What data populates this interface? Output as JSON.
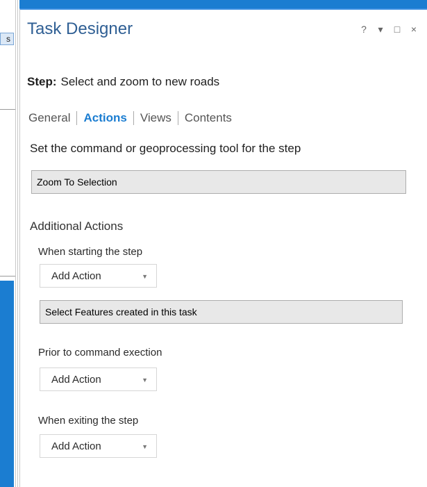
{
  "background": {
    "left_tab_label": "s"
  },
  "pane": {
    "title": "Task Designer",
    "controls": {
      "help": "?",
      "dropdown": "▾",
      "maximize": "□",
      "close": "×"
    }
  },
  "step": {
    "label": "Step:",
    "name": "Select and zoom to new roads"
  },
  "tabs": [
    {
      "label": "General",
      "active": false
    },
    {
      "label": "Actions",
      "active": true
    },
    {
      "label": "Views",
      "active": false
    },
    {
      "label": "Contents",
      "active": false
    }
  ],
  "command": {
    "heading": "Set the command or geoprocessing tool for the step",
    "value": "Zoom To Selection"
  },
  "additional_actions": {
    "heading": "Additional Actions",
    "starting": {
      "label": "When starting the step",
      "add_action": "Add Action",
      "selected_action": "Select Features created in this task"
    },
    "prior": {
      "label": "Prior to command exection",
      "add_action": "Add Action"
    },
    "exiting": {
      "label": "When exiting the step",
      "add_action": "Add Action"
    }
  },
  "colors": {
    "accent": "#1b7dd1",
    "title": "#2f5f94"
  }
}
